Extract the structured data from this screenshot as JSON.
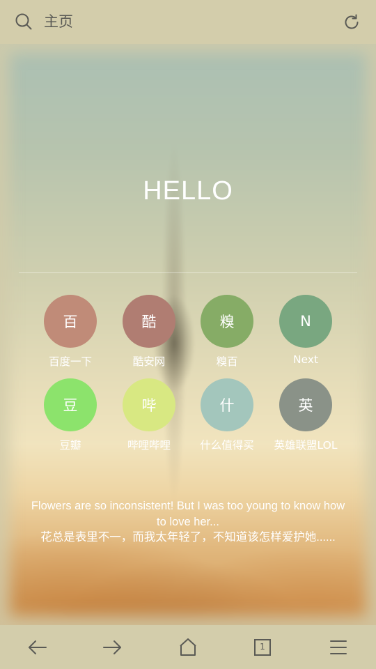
{
  "topbar": {
    "title": "主页",
    "search_icon": "search-icon",
    "refresh_icon": "refresh-icon"
  },
  "hero": {
    "greeting": "HELLO"
  },
  "shortcuts": [
    {
      "glyph": "百",
      "label": "百度一下",
      "color": "#c08b78"
    },
    {
      "glyph": "酷",
      "label": "酷安网",
      "color": "#b07d72"
    },
    {
      "glyph": "糗",
      "label": "糗百",
      "color": "#86ac66"
    },
    {
      "glyph": "N",
      "label": "Next",
      "color": "#79a780"
    },
    {
      "glyph": "豆",
      "label": "豆瓣",
      "color": "#8ce36c"
    },
    {
      "glyph": "哔",
      "label": "哔哩哔哩",
      "color": "#d8e882"
    },
    {
      "glyph": "什",
      "label": "什么值得买",
      "color": "#a3c6bc"
    },
    {
      "glyph": "英",
      "label": "英雄联盟LOL",
      "color": "#8a9288"
    }
  ],
  "quote": {
    "english": "Flowers are so inconsistent! But I was too young to know how to love her...",
    "chinese": "花总是表里不一，而我太年轻了，不知道该怎样爱护她......"
  },
  "bottombar": {
    "tab_count": "1",
    "icons": [
      "back-arrow-icon",
      "forward-arrow-icon",
      "home-icon",
      "tabs-icon",
      "menu-icon"
    ]
  },
  "colors": {
    "bar_background": "#d3cdab",
    "icon_color": "#5a5a55"
  }
}
